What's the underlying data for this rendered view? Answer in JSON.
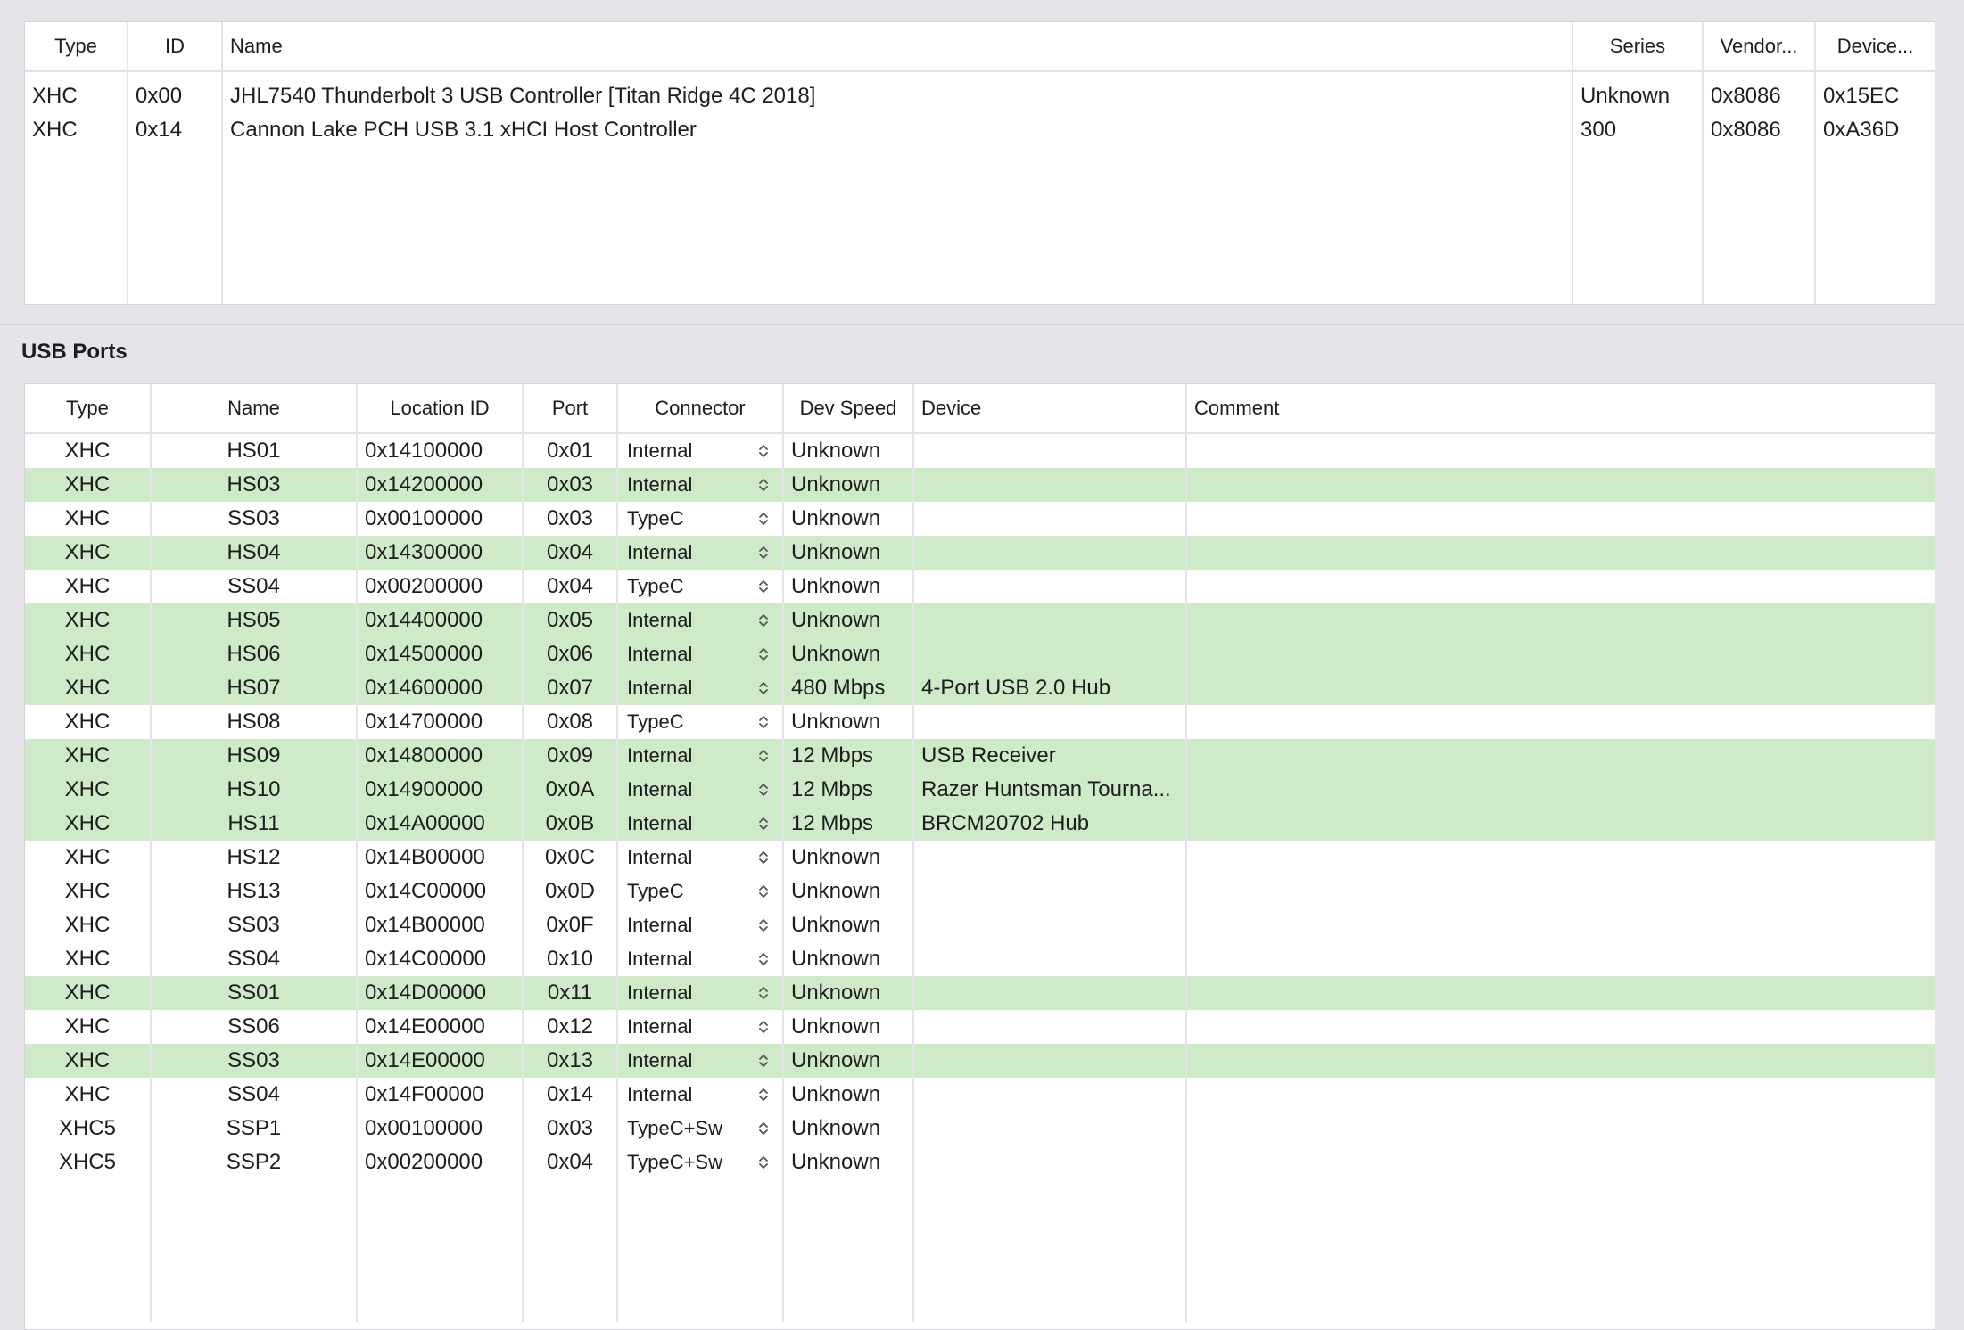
{
  "controllers": {
    "columns": [
      "Type",
      "ID",
      "Name",
      "Series",
      "Vendor...",
      "Device..."
    ],
    "rows": [
      {
        "type": "XHC",
        "id": "0x00",
        "name": "JHL7540 Thunderbolt 3 USB Controller [Titan Ridge 4C 2018]",
        "series": "Unknown",
        "vendor": "0x8086",
        "device": "0x15EC"
      },
      {
        "type": "XHC",
        "id": "0x14",
        "name": "Cannon Lake PCH USB 3.1 xHCI Host Controller",
        "series": "300",
        "vendor": "0x8086",
        "device": "0xA36D"
      }
    ]
  },
  "ports": {
    "title": "USB Ports",
    "columns": [
      "Type",
      "Name",
      "Location ID",
      "Port",
      "Connector",
      "Dev Speed",
      "Device",
      "Comment"
    ],
    "active_color": "#cfeac9",
    "rows": [
      {
        "type": "XHC",
        "name": "HS01",
        "location": "0x14100000",
        "port": "0x01",
        "connector": "Internal",
        "speed": "Unknown",
        "device": "",
        "comment": "",
        "active": false
      },
      {
        "type": "XHC",
        "name": "HS03",
        "location": "0x14200000",
        "port": "0x03",
        "connector": "Internal",
        "speed": "Unknown",
        "device": "",
        "comment": "",
        "active": true
      },
      {
        "type": "XHC",
        "name": "SS03",
        "location": "0x00100000",
        "port": "0x03",
        "connector": "TypeC",
        "speed": "Unknown",
        "device": "",
        "comment": "",
        "active": false
      },
      {
        "type": "XHC",
        "name": "HS04",
        "location": "0x14300000",
        "port": "0x04",
        "connector": "Internal",
        "speed": "Unknown",
        "device": "",
        "comment": "",
        "active": true
      },
      {
        "type": "XHC",
        "name": "SS04",
        "location": "0x00200000",
        "port": "0x04",
        "connector": "TypeC",
        "speed": "Unknown",
        "device": "",
        "comment": "",
        "active": false
      },
      {
        "type": "XHC",
        "name": "HS05",
        "location": "0x14400000",
        "port": "0x05",
        "connector": "Internal",
        "speed": "Unknown",
        "device": "",
        "comment": "",
        "active": true
      },
      {
        "type": "XHC",
        "name": "HS06",
        "location": "0x14500000",
        "port": "0x06",
        "connector": "Internal",
        "speed": "Unknown",
        "device": "",
        "comment": "",
        "active": true
      },
      {
        "type": "XHC",
        "name": "HS07",
        "location": "0x14600000",
        "port": "0x07",
        "connector": "Internal",
        "speed": "480 Mbps",
        "device": "4-Port USB 2.0 Hub",
        "comment": "",
        "active": true
      },
      {
        "type": "XHC",
        "name": "HS08",
        "location": "0x14700000",
        "port": "0x08",
        "connector": "TypeC",
        "speed": "Unknown",
        "device": "",
        "comment": "",
        "active": false
      },
      {
        "type": "XHC",
        "name": "HS09",
        "location": "0x14800000",
        "port": "0x09",
        "connector": "Internal",
        "speed": "12 Mbps",
        "device": "USB Receiver",
        "comment": "",
        "active": true
      },
      {
        "type": "XHC",
        "name": "HS10",
        "location": "0x14900000",
        "port": "0x0A",
        "connector": "Internal",
        "speed": "12 Mbps",
        "device": "Razer Huntsman Tourna...",
        "comment": "",
        "active": true
      },
      {
        "type": "XHC",
        "name": "HS11",
        "location": "0x14A00000",
        "port": "0x0B",
        "connector": "Internal",
        "speed": "12 Mbps",
        "device": "BRCM20702 Hub",
        "comment": "",
        "active": true
      },
      {
        "type": "XHC",
        "name": "HS12",
        "location": "0x14B00000",
        "port": "0x0C",
        "connector": "Internal",
        "speed": "Unknown",
        "device": "",
        "comment": "",
        "active": false
      },
      {
        "type": "XHC",
        "name": "HS13",
        "location": "0x14C00000",
        "port": "0x0D",
        "connector": "TypeC",
        "speed": "Unknown",
        "device": "",
        "comment": "",
        "active": false
      },
      {
        "type": "XHC",
        "name": "SS03",
        "location": "0x14B00000",
        "port": "0x0F",
        "connector": "Internal",
        "speed": "Unknown",
        "device": "",
        "comment": "",
        "active": false
      },
      {
        "type": "XHC",
        "name": "SS04",
        "location": "0x14C00000",
        "port": "0x10",
        "connector": "Internal",
        "speed": "Unknown",
        "device": "",
        "comment": "",
        "active": false
      },
      {
        "type": "XHC",
        "name": "SS01",
        "location": "0x14D00000",
        "port": "0x11",
        "connector": "Internal",
        "speed": "Unknown",
        "device": "",
        "comment": "",
        "active": true
      },
      {
        "type": "XHC",
        "name": "SS06",
        "location": "0x14E00000",
        "port": "0x12",
        "connector": "Internal",
        "speed": "Unknown",
        "device": "",
        "comment": "",
        "active": false
      },
      {
        "type": "XHC",
        "name": "SS03",
        "location": "0x14E00000",
        "port": "0x13",
        "connector": "Internal",
        "speed": "Unknown",
        "device": "",
        "comment": "",
        "active": true
      },
      {
        "type": "XHC",
        "name": "SS04",
        "location": "0x14F00000",
        "port": "0x14",
        "connector": "Internal",
        "speed": "Unknown",
        "device": "",
        "comment": "",
        "active": false
      },
      {
        "type": "XHC5",
        "name": "SSP1",
        "location": "0x00100000",
        "port": "0x03",
        "connector": "TypeC+Sw",
        "speed": "Unknown",
        "device": "",
        "comment": "",
        "active": false
      },
      {
        "type": "XHC5",
        "name": "SSP2",
        "location": "0x00200000",
        "port": "0x04",
        "connector": "TypeC+Sw",
        "speed": "Unknown",
        "device": "",
        "comment": "",
        "active": false
      }
    ]
  }
}
